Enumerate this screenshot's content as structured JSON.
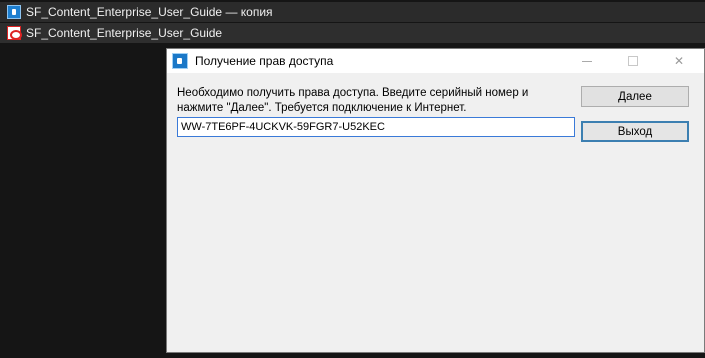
{
  "background_windows": [
    {
      "icon": "app-icon",
      "label": "SF_Content_Enterprise_User_Guide — копия"
    },
    {
      "icon": "pdf-icon",
      "label": "SF_Content_Enterprise_User_Guide"
    }
  ],
  "dialog": {
    "title": "Получение прав доступа",
    "message": "Необходимо получить права доступа. Введите серийный номер и нажмите \"Далее\". Требуется подключение к Интернет.",
    "serial_value": "WW-7TE6PF-4UCKVK-59FGR7-U52KEC",
    "next_label": "Далее",
    "exit_label": "Выход",
    "close_glyph": "✕"
  },
  "colors": {
    "background": "#151515",
    "dialog_bg": "#f0f0f0",
    "input_focus_border": "#3a7ad8",
    "default_button_border": "#3c7fb1"
  }
}
